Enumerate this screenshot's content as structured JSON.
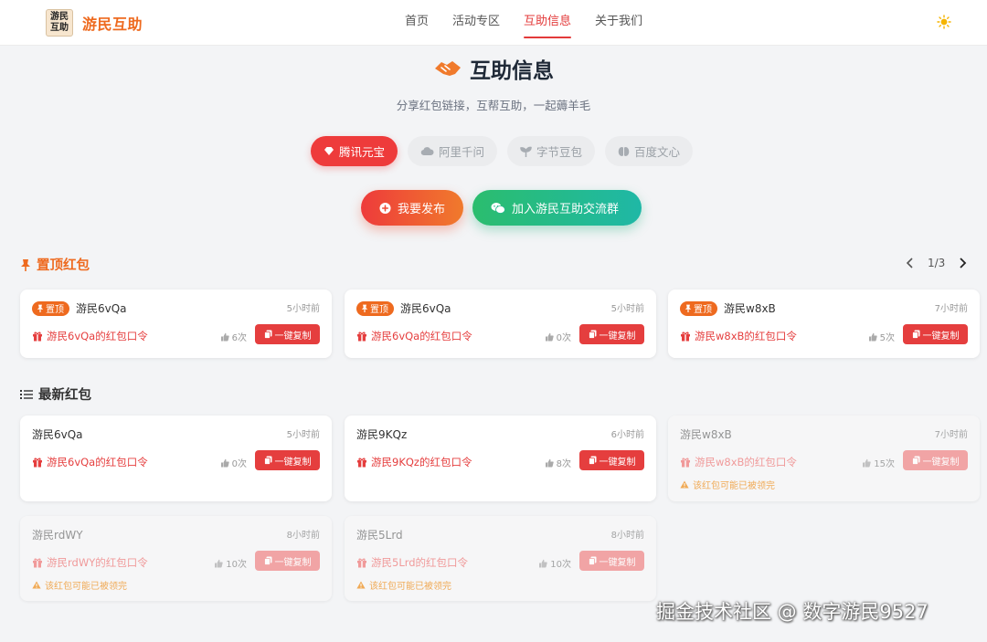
{
  "header": {
    "logo_text_line1": "游民",
    "logo_text_line2": "互助",
    "brand": "游民互助",
    "nav": [
      {
        "label": "首页",
        "active": false
      },
      {
        "label": "活动专区",
        "active": false
      },
      {
        "label": "互助信息",
        "active": true
      },
      {
        "label": "关于我们",
        "active": false
      }
    ],
    "theme_icon": "sun-icon"
  },
  "hero": {
    "title": "互助信息",
    "subtitle": "分享红包链接，互帮互助，一起薅羊毛",
    "icon": "handshake-icon"
  },
  "tabs": [
    {
      "label": "腾讯元宝",
      "icon": "gem-icon",
      "active": true
    },
    {
      "label": "阿里千问",
      "icon": "cloud-icon",
      "active": false
    },
    {
      "label": "字节豆包",
      "icon": "sprout-icon",
      "active": false
    },
    {
      "label": "百度文心",
      "icon": "brain-icon",
      "active": false
    }
  ],
  "actions": {
    "publish_label": "我要发布",
    "join_label": "加入游民互助交流群"
  },
  "pinned": {
    "title": "置顶红包",
    "page": "1/3",
    "badge": "置顶",
    "cards": [
      {
        "user": "游民6vQa",
        "time": "5小时前",
        "code": "游民6vQa的红包口令",
        "likes": "6次",
        "copy": "一键复制"
      },
      {
        "user": "游民6vQa",
        "time": "5小时前",
        "code": "游民6vQa的红包口令",
        "likes": "0次",
        "copy": "一键复制"
      },
      {
        "user": "游民w8xB",
        "time": "7小时前",
        "code": "游民w8xB的红包口令",
        "likes": "5次",
        "copy": "一键复制"
      }
    ]
  },
  "latest": {
    "title": "最新红包",
    "warning": "该红包可能已被领完",
    "cards": [
      {
        "user": "游民6vQa",
        "time": "5小时前",
        "code": "游民6vQa的红包口令",
        "likes": "0次",
        "copy": "一键复制"
      },
      {
        "user": "游民9KQz",
        "time": "6小时前",
        "code": "游民9KQz的红包口令",
        "likes": "8次",
        "copy": "一键复制"
      },
      {
        "user": "游民w8xB",
        "time": "7小时前",
        "code": "游民w8xB的红包口令",
        "likes": "15次",
        "copy": "一键复制"
      },
      {
        "user": "游民rdWY",
        "time": "8小时前",
        "code": "游民rdWY的红包口令",
        "likes": "10次",
        "copy": "一键复制"
      },
      {
        "user": "游民5Lrd",
        "time": "8小时前",
        "code": "游民5Lrd的红包口令",
        "likes": "10次",
        "copy": "一键复制"
      }
    ]
  },
  "watermark": "掘金技术社区 @ 数字游民9527",
  "colors": {
    "accent_red": "#ee3b3b",
    "accent_orange": "#ee6a1f",
    "accent_green": "#2bbd6e",
    "warning": "#f0a040"
  }
}
